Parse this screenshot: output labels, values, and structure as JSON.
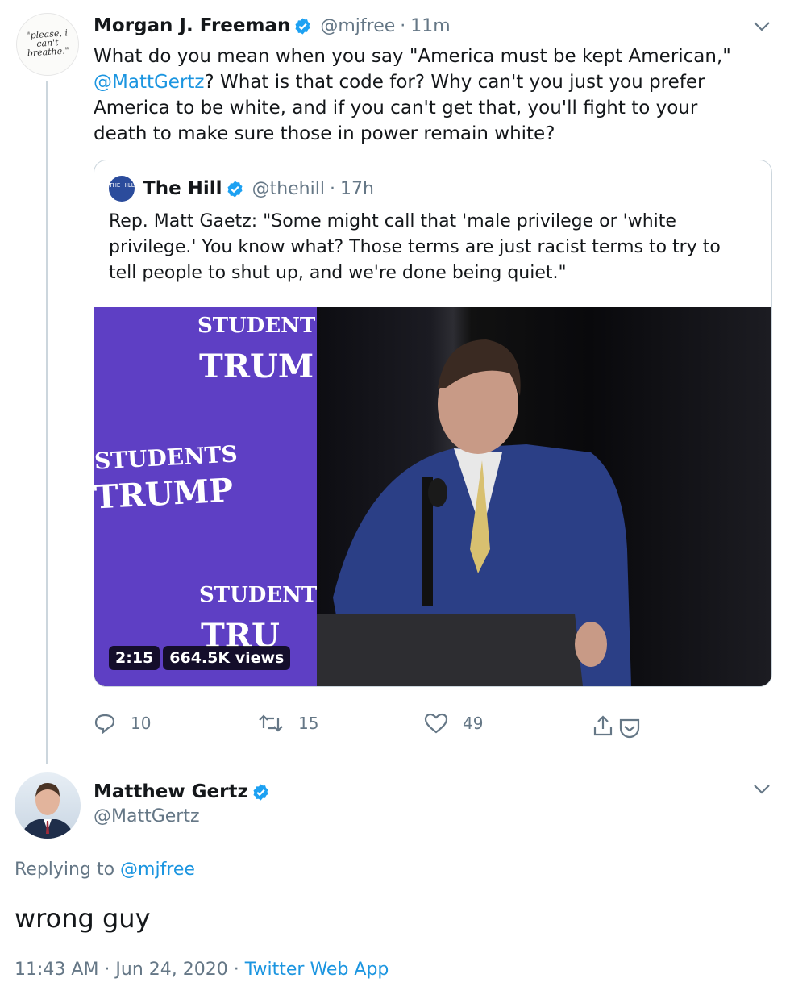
{
  "parent_tweet": {
    "display_name": "Morgan J. Freeman",
    "handle": "@mjfree",
    "separator": "·",
    "time": "11m",
    "avatar_text": "\"please, i can't breathe.\"",
    "text_line1": "What do you mean when you say \"America must be kept American,\"",
    "mention": "@MattGertz",
    "text_rest": "? What is that code for? Why can't you just you prefer America to be white, and if you can't get that, you'll fight to your death to make sure those in power remain white?",
    "quoted": {
      "display_name": "The Hill",
      "handle": "@thehill",
      "separator": "·",
      "time": "17h",
      "logo_text": "THE HILL",
      "text": "Rep. Matt Gaetz: \"Some might call that 'male privilege or 'white privilege.' You know what? Those terms are just racist terms to try to tell people to shut up, and we're done being quiet.\"",
      "video": {
        "duration": "2:15",
        "views": "664.5K views",
        "banner_lines": [
          "STUDENTS",
          "TRUM",
          "STUDENTS",
          "TRUMP",
          "STUDENTS",
          "TRU"
        ]
      }
    },
    "actions": {
      "reply_count": "10",
      "retweet_count": "15",
      "like_count": "49"
    }
  },
  "reply_tweet": {
    "display_name": "Matthew Gertz",
    "handle": "@MattGertz",
    "replying_prefix": "Replying to",
    "replying_handle": "@mjfree",
    "text": "wrong guy",
    "timestamp": "11:43 AM · Jun 24, 2020 ·",
    "source": "Twitter Web App"
  },
  "colors": {
    "link": "#1b95e0",
    "muted": "#657786",
    "verified": "#1da1f2",
    "banner": "#5e3fc4",
    "border": "#ccd6dd"
  },
  "icons": [
    "verified-badge-icon",
    "chevron-down-icon",
    "reply-icon",
    "retweet-icon",
    "like-icon",
    "share-icon",
    "bookmark-icon"
  ]
}
